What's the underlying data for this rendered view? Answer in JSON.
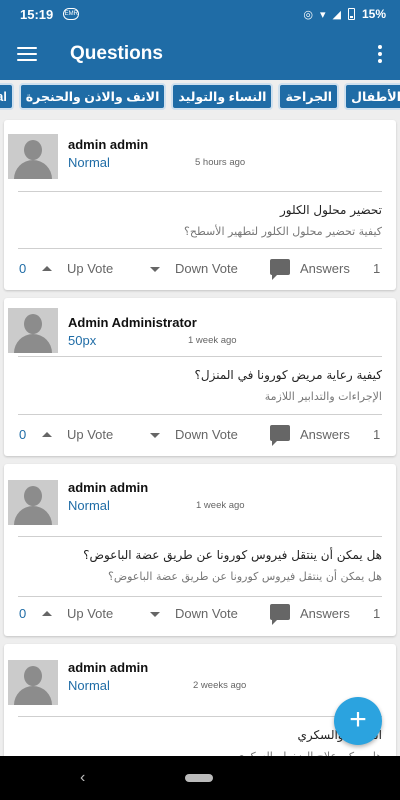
{
  "status_bar": {
    "time": "15:19",
    "notification_badge": "EMR",
    "battery": "15%"
  },
  "app_bar": {
    "title": "Questions",
    "menu_icon": "menu-icon",
    "more_icon": "more-vert-icon"
  },
  "tabs": [
    "الأطفال",
    "الجراحة",
    "النساء والتوليد",
    "الانف والاذن والحنجرة",
    "General"
  ],
  "questions": [
    {
      "user": "admin admin",
      "role": "Normal",
      "time_ago": "5 hours ago",
      "title": "تحضير محلول الكلور",
      "description": "كيفية تحضير محلول الكلور لتطهير الأسطح؟",
      "up_count": "0",
      "up_label": "Up Vote",
      "down_label": "Down Vote",
      "answers_label": "Answers",
      "answers_count": "1"
    },
    {
      "user": "Admin Administrator",
      "role": "50px",
      "time_ago": "1 week ago",
      "title": "كيفية رعاية مريض كورونا في المنزل؟",
      "description": "الإجراءات والتدابير اللازمة",
      "up_count": "0",
      "up_label": "Up Vote",
      "down_label": "Down Vote",
      "answers_label": "Answers",
      "answers_count": "1"
    },
    {
      "user": "admin admin",
      "role": "Normal",
      "time_ago": "1 week ago",
      "title": "هل يمكن أن ينتقل فيروس كورونا عن طريق عضة الباعوض؟",
      "description": "هل يمكن أن ينتقل فيروس كورونا عن طريق عضة الباعوض؟",
      "up_count": "0",
      "up_label": "Up Vote",
      "down_label": "Down Vote",
      "answers_label": "Answers",
      "answers_count": "1"
    },
    {
      "user": "admin admin",
      "role": "Normal",
      "time_ago": "2 weeks ago",
      "title": "الضغط والسكري",
      "description": "هل يمكن علاج الضغط والسكري"
    }
  ],
  "fab": {
    "label": "+"
  },
  "nav": {
    "back": "‹"
  },
  "colors": {
    "primary": "#1f6ca6",
    "fab": "#2ba3df"
  }
}
